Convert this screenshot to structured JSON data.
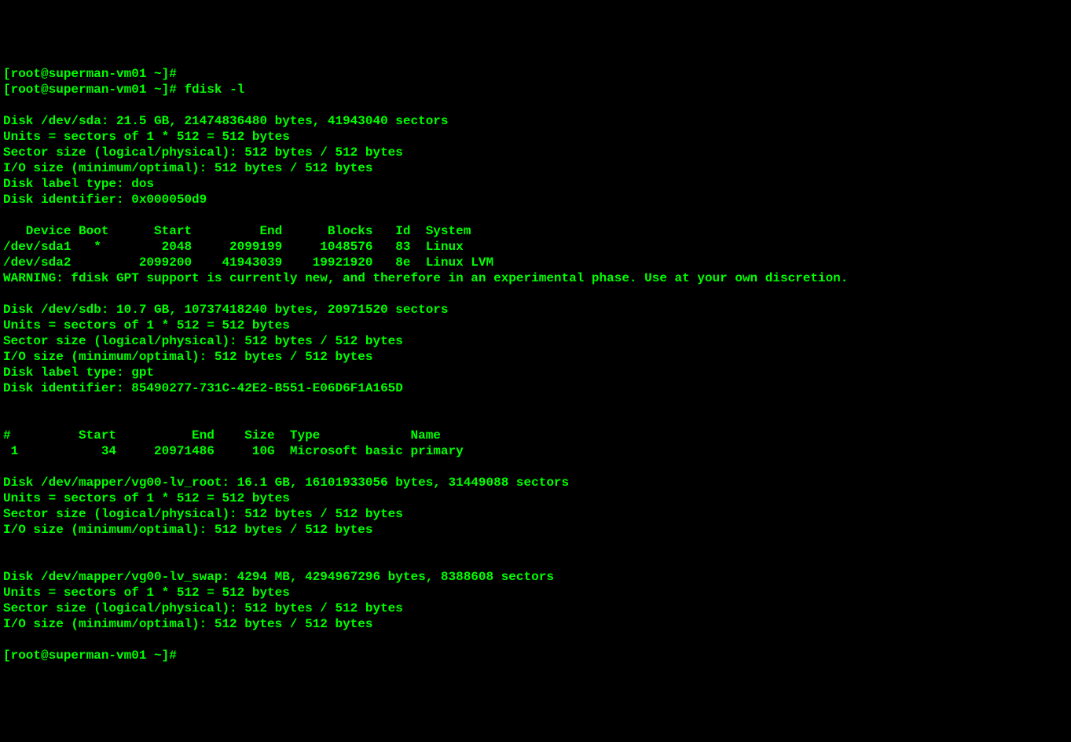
{
  "prompt": "[root@superman-vm01 ~]#",
  "command": "fdisk -l",
  "disks": {
    "sda": {
      "header": "Disk /dev/sda: 21.5 GB, 21474836480 bytes, 41943040 sectors",
      "units": "Units = sectors of 1 * 512 = 512 bytes",
      "sector_size": "Sector size (logical/physical): 512 bytes / 512 bytes",
      "io_size": "I/O size (minimum/optimal): 512 bytes / 512 bytes",
      "label_type": "Disk label type: dos",
      "identifier": "Disk identifier: 0x000050d9",
      "table_header": "   Device Boot      Start         End      Blocks   Id  System",
      "partitions": [
        "/dev/sda1   *        2048     2099199     1048576   83  Linux",
        "/dev/sda2         2099200    41943039    19921920   8e  Linux LVM"
      ]
    },
    "warning": "WARNING: fdisk GPT support is currently new, and therefore in an experimental phase. Use at your own discretion.",
    "sdb": {
      "header": "Disk /dev/sdb: 10.7 GB, 10737418240 bytes, 20971520 sectors",
      "units": "Units = sectors of 1 * 512 = 512 bytes",
      "sector_size": "Sector size (logical/physical): 512 bytes / 512 bytes",
      "io_size": "I/O size (minimum/optimal): 512 bytes / 512 bytes",
      "label_type": "Disk label type: gpt",
      "identifier": "Disk identifier: 85490277-731C-42E2-B551-E06D6F1A165D",
      "table_header": "#         Start          End    Size  Type            Name",
      "partitions": [
        " 1           34     20971486     10G  Microsoft basic primary"
      ]
    },
    "lv_root": {
      "header": "Disk /dev/mapper/vg00-lv_root: 16.1 GB, 16101933056 bytes, 31449088 sectors",
      "units": "Units = sectors of 1 * 512 = 512 bytes",
      "sector_size": "Sector size (logical/physical): 512 bytes / 512 bytes",
      "io_size": "I/O size (minimum/optimal): 512 bytes / 512 bytes"
    },
    "lv_swap": {
      "header": "Disk /dev/mapper/vg00-lv_swap: 4294 MB, 4294967296 bytes, 8388608 sectors",
      "units": "Units = sectors of 1 * 512 = 512 bytes",
      "sector_size": "Sector size (logical/physical): 512 bytes / 512 bytes",
      "io_size": "I/O size (minimum/optimal): 512 bytes / 512 bytes"
    }
  }
}
